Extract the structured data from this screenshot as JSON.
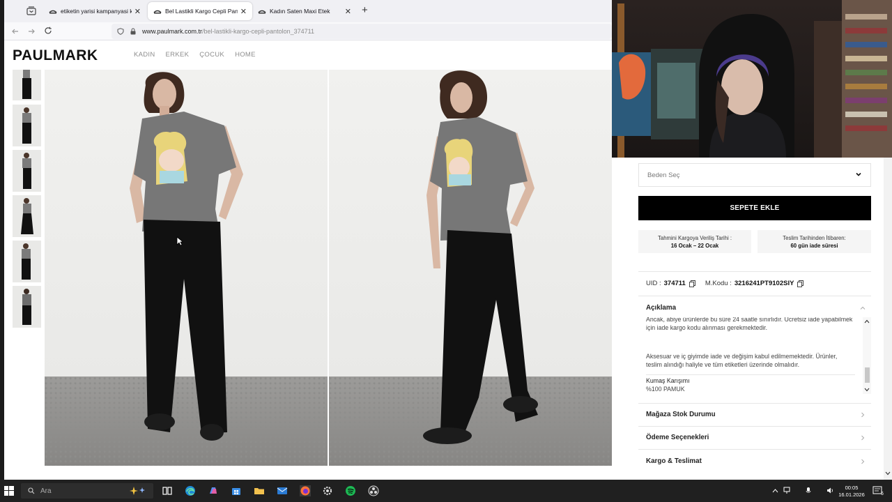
{
  "browser": {
    "tabs": [
      {
        "title": "etiketin yarisi kampanyasi kadın",
        "active": false
      },
      {
        "title": "Bel Lastikli Kargo Cepli Pantolon",
        "active": true
      },
      {
        "title": "Kadın Saten Maxi Etek",
        "active": false
      }
    ],
    "close_glyph": "✕",
    "new_tab": "+",
    "url_domain": "www.paulmark.com.tr",
    "url_path": "/bel-lastikli-kargo-cepli-pantolon_374711"
  },
  "site": {
    "logo": "PAULMARK",
    "menu": [
      "KADIN",
      "ERKEK",
      "ÇOCUK",
      "HOME"
    ]
  },
  "product": {
    "size_placeholder": "Beden Seç",
    "add_to_cart": "SEPETE EKLE",
    "shipping_label": "Tahmini Kargoya Veriliş Tarihi :",
    "shipping_value": "16 Ocak – 22 Ocak",
    "return_label": "Teslim Tarihinden İtibaren:",
    "return_value": "60 gün iade süresi",
    "uid_label": "UID :",
    "uid_value": "374711",
    "code_label": "M.Kodu :",
    "code_value": "3216241PT9102SIY",
    "description_title": "Açıklama",
    "description_lines": [
      "Ancak, abiye ürünlerde bu süre 24 saatle sınırlıdır. Ücretsiz iade yapabilmek",
      "için iade kargo kodu alınması gerekmektedir.",
      "Aksesuar ve iç giyimde iade ve değişim kabul edilmemektedir. Ürünler,",
      "teslim alındığı haliyle ve tüm etiketleri üzerinde olmalıdır."
    ],
    "fabric_label": "Kumaş Karışımı",
    "fabric_value": "%100 PAMUK",
    "sections": [
      "Mağaza Stok Durumu",
      "Ödeme Seçenekleri",
      "Kargo & Teslimat"
    ]
  },
  "taskbar": {
    "search_placeholder": "Ara",
    "time": "00:05",
    "date": "16.01.2026",
    "notification_count": "6"
  },
  "colors": {
    "accent_black": "#000000",
    "firefox_orange": "#ff7139",
    "spotify_green": "#1db954"
  },
  "icons": [
    "tab-list-icon",
    "back-icon",
    "forward-icon",
    "reload-icon",
    "shield-icon",
    "lock-icon",
    "chevron-down-icon",
    "copy-icon",
    "chevron-right-icon",
    "windows-icon",
    "search-icon",
    "task-view-icon",
    "edge-icon",
    "copilot-icon",
    "store-icon",
    "explorer-icon",
    "mail-icon",
    "firefox-icon",
    "settings-icon",
    "spotify-icon",
    "obs-icon"
  ]
}
